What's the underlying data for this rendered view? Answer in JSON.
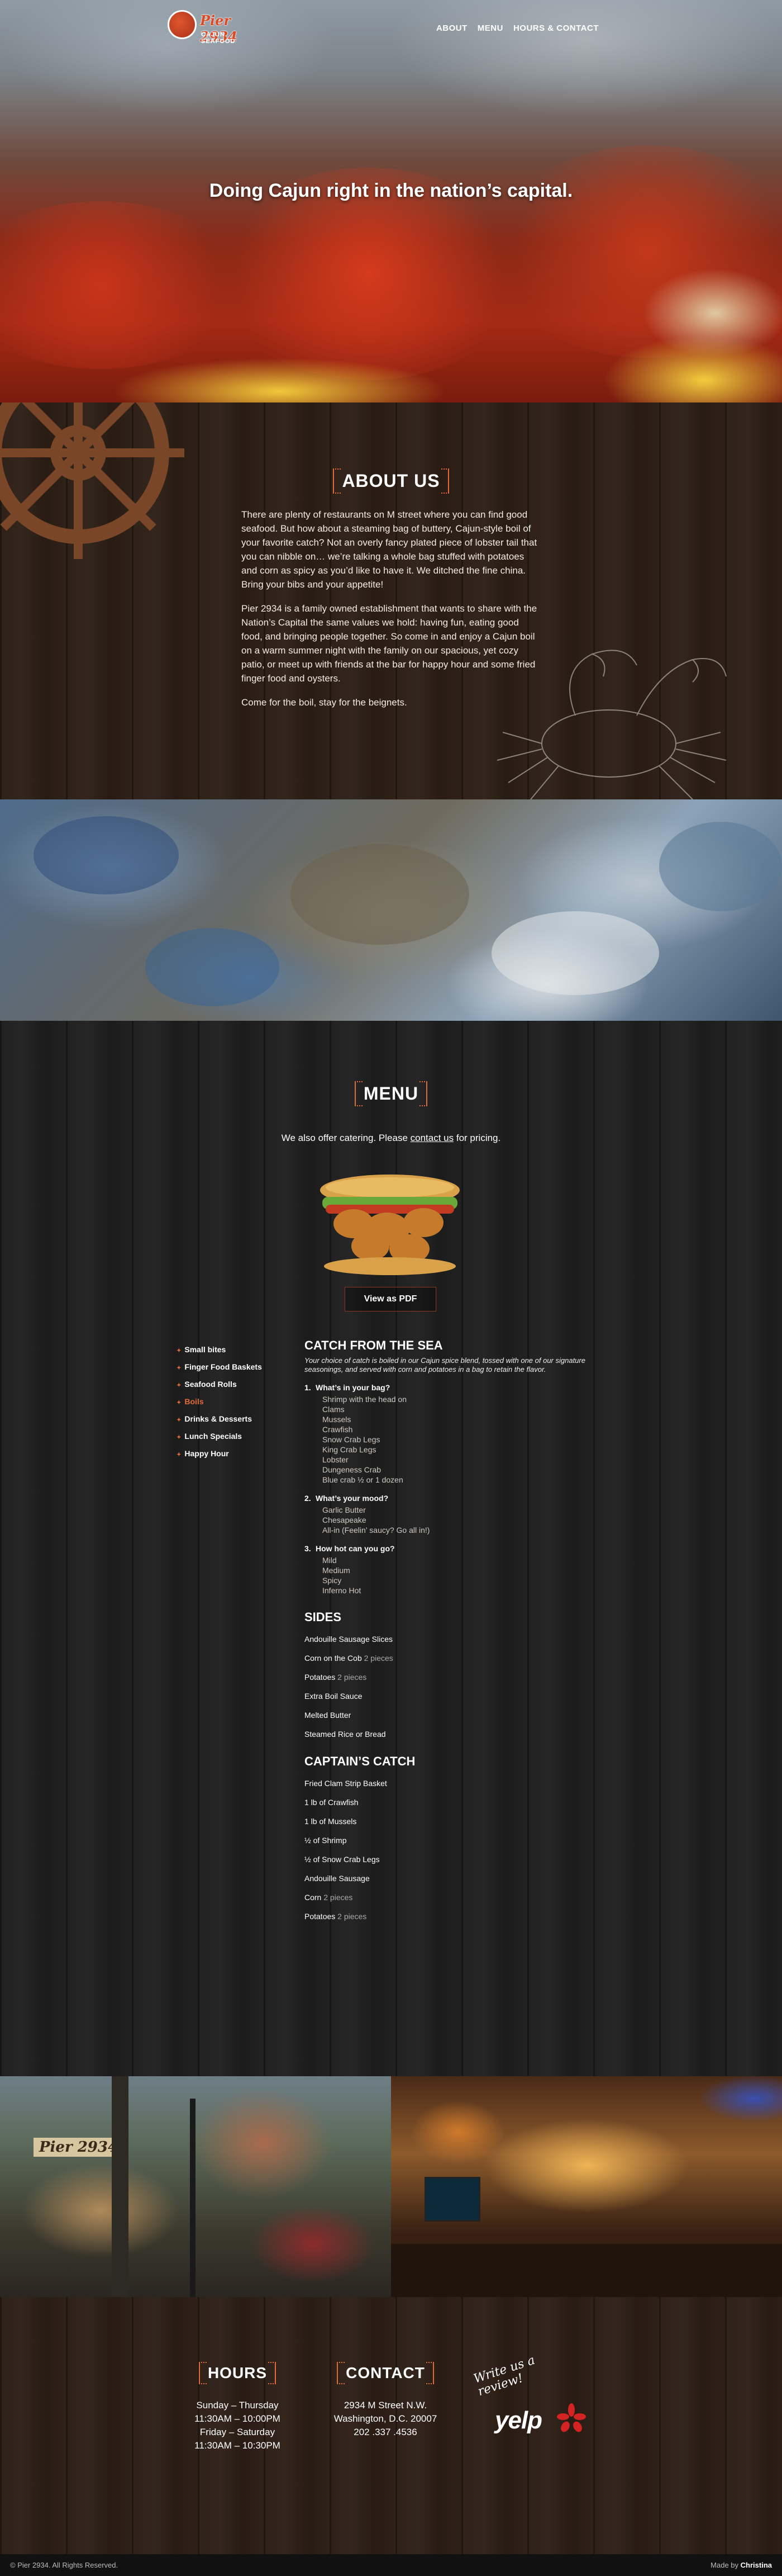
{
  "header": {
    "logo_name": "Pier 2934",
    "logo_sub": "CAJUN SEAFOOD",
    "nav": [
      "ABOUT",
      "MENU",
      "HOURS & CONTACT"
    ]
  },
  "hero": {
    "tagline": "Doing Cajun right in the nation’s capital."
  },
  "about": {
    "title": "ABOUT US",
    "paragraphs": [
      "There are plenty of restaurants on M street where you can find good seafood. But how about a steaming bag of buttery, Cajun-style boil of your favorite catch? Not an overly fancy plated piece of lobster tail that you can nibble on… we’re talking a whole bag stuffed with potatoes and corn as spicy as you’d like to have it. We ditched the fine china. Bring your bibs and your appetite!",
      "Pier 2934 is a family owned establishment that wants to share with the Nation’s Capital the same values we hold: having fun, eating good food, and bringing people together. So come in and enjoy a Cajun boil on a warm summer night with the family on our spacious, yet cozy patio, or meet up with friends at the bar for happy hour and some fried finger food and oysters.",
      "Come for the boil, stay for the beignets."
    ]
  },
  "menu": {
    "title": "MENU",
    "catering_prefix": "We also offer catering. Please ",
    "catering_link": "contact us",
    "catering_suffix": " for pricing.",
    "pdf_button": "View as PDF",
    "nav": [
      "Small bites",
      "Finger Food Baskets",
      "Seafood Rolls",
      "Boils",
      "Drinks & Desserts",
      "Lunch Specials",
      "Happy Hour"
    ],
    "active_nav": "Boils",
    "catch_title": "CATCH FROM THE SEA",
    "catch_desc": "Your choice of catch is boiled in our Cajun spice blend, tossed with one of our signature seasonings, and served with corn and potatoes in a bag to retain the flavor.",
    "questions": [
      {
        "num": "1.",
        "title": "What’s in your bag?",
        "options": [
          "Shrimp with the head on",
          "Clams",
          "Mussels",
          "Crawfish",
          "Snow Crab Legs",
          "King Crab Legs",
          "Lobster",
          "Dungeness Crab",
          "Blue crab ½ or 1 dozen"
        ]
      },
      {
        "num": "2.",
        "title": "What’s your mood?",
        "options": [
          "Garlic Butter",
          "Chesapeake",
          "All-in (Feelin’ saucy? Go all in!)"
        ]
      },
      {
        "num": "3.",
        "title": "How hot can you go?",
        "options": [
          "Mild",
          "Medium",
          "Spicy",
          "Inferno Hot"
        ]
      }
    ],
    "sides_title": "SIDES",
    "sides": [
      {
        "name": "Andouille Sausage Slices",
        "qty": ""
      },
      {
        "name": "Corn on the Cob",
        "qty": "2 pieces"
      },
      {
        "name": "Potatoes",
        "qty": "2 pieces"
      },
      {
        "name": "Extra Boil Sauce",
        "qty": ""
      },
      {
        "name": "Melted Butter",
        "qty": ""
      },
      {
        "name": "Steamed Rice or Bread",
        "qty": ""
      }
    ],
    "captain_title": "CAPTAIN’S CATCH",
    "captain": [
      {
        "name": "Fried Clam Strip Basket",
        "qty": ""
      },
      {
        "name": "1 lb of Crawfish",
        "qty": ""
      },
      {
        "name": "1 lb of Mussels",
        "qty": ""
      },
      {
        "name": "½ of Shrimp",
        "qty": ""
      },
      {
        "name": "½ of Snow Crab Legs",
        "qty": ""
      },
      {
        "name": "Andouille Sausage",
        "qty": ""
      },
      {
        "name": "Corn",
        "qty": "2 pieces"
      },
      {
        "name": "Potatoes",
        "qty": "2 pieces"
      }
    ]
  },
  "photos": {
    "sign": "Pier 2934"
  },
  "hours": {
    "title": "HOURS",
    "lines": [
      "Sunday – Thursday",
      "11:30AM – 10:00PM",
      "Friday – Saturday",
      "11:30AM – 10:30PM"
    ]
  },
  "contact": {
    "title": "CONTACT",
    "lines": [
      "2934 M Street N.W.",
      "Washington, D.C. 20007",
      "202 .337 .4536"
    ]
  },
  "review": {
    "handwritten_line1": "Write us a",
    "handwritten_line2": "review!",
    "yelp": "yelp"
  },
  "footer": {
    "copyright": "© Pier 2934. All Rights Reserved.",
    "made_by_prefix": "Made by ",
    "made_by_name": "Christina"
  },
  "colors": {
    "accent": "#e06a3a",
    "wood_brown": "#2b1d14",
    "wood_black": "#1d1d1d"
  }
}
